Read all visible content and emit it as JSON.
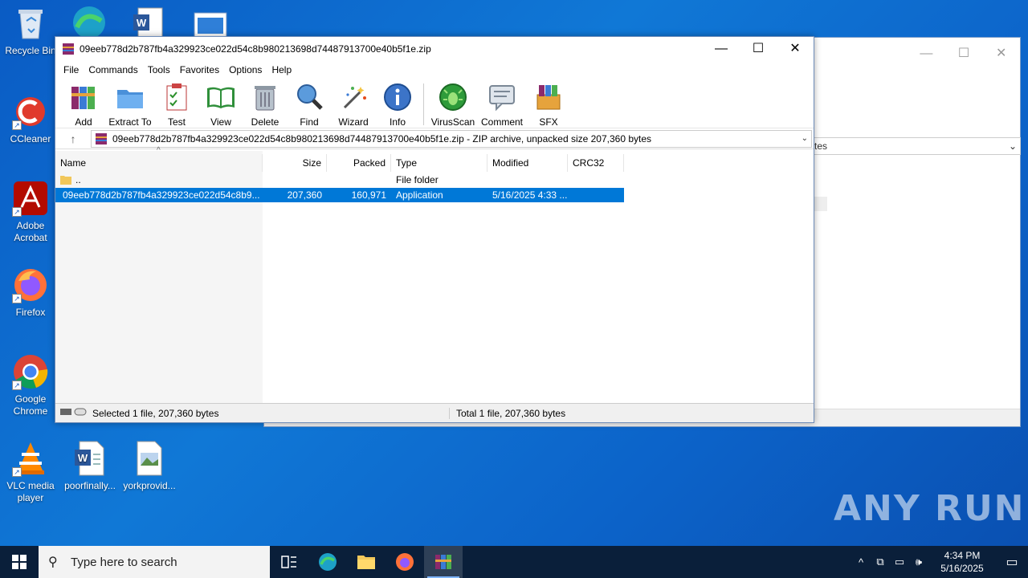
{
  "desktop": {
    "icons": [
      {
        "label": "Recycle Bin"
      },
      {
        "label": "CCleaner"
      },
      {
        "label": "Adobe Acrobat"
      },
      {
        "label": "Firefox"
      },
      {
        "label": "Google Chrome"
      },
      {
        "label": "VLC media player"
      },
      {
        "label": "poorfinally..."
      },
      {
        "label": "yorkprovid..."
      }
    ]
  },
  "bg_window": {
    "addr_tail": "tes"
  },
  "winrar": {
    "title": "09eeb778d2b787fb4a329923ce022d54c8b980213698d74487913700e40b5f1e.zip",
    "menu": [
      "File",
      "Commands",
      "Tools",
      "Favorites",
      "Options",
      "Help"
    ],
    "toolbar": [
      "Add",
      "Extract To",
      "Test",
      "View",
      "Delete",
      "Find",
      "Wizard",
      "Info",
      "VirusScan",
      "Comment",
      "SFX"
    ],
    "path": "09eeb778d2b787fb4a329923ce022d54c8b980213698d74487913700e40b5f1e.zip - ZIP archive, unpacked size 207,360 bytes",
    "columns": {
      "name": "Name",
      "size": "Size",
      "packed": "Packed",
      "type": "Type",
      "modified": "Modified",
      "crc": "CRC32"
    },
    "rows": [
      {
        "name": "..",
        "size": "",
        "packed": "",
        "type": "File folder",
        "modified": "",
        "crc": ""
      },
      {
        "name": "09eeb778d2b787fb4a329923ce022d54c8b9...",
        "size": "207,360",
        "packed": "160,971",
        "type": "Application",
        "modified": "5/16/2025 4:33 ...",
        "crc": ""
      }
    ],
    "status_left": "Selected 1 file, 207,360 bytes",
    "status_right": "Total 1 file, 207,360 bytes"
  },
  "taskbar": {
    "search_placeholder": "Type here to search",
    "time": "4:34 PM",
    "date": "5/16/2025"
  },
  "watermark": "ANY RUN"
}
